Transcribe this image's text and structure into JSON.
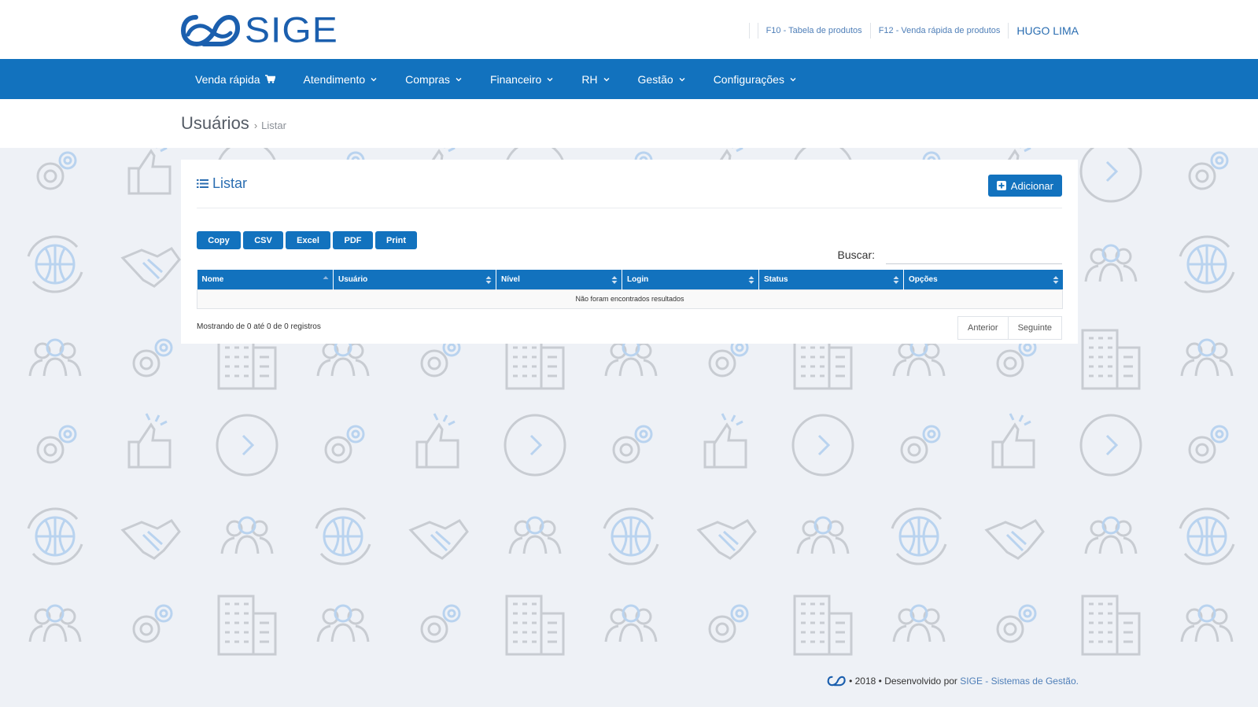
{
  "brand": {
    "name": "SIGE",
    "primary": "#1272be",
    "dark": "#1b5fae"
  },
  "topbar": {
    "links": [
      "F10 - Tabela de produtos",
      "F12 - Venda rápida de produtos"
    ],
    "user": "HUGO LIMA"
  },
  "nav": {
    "items": [
      {
        "label": "Venda rápida",
        "icon": "cart-icon"
      },
      {
        "label": "Atendimento",
        "icon": "chevron-down-icon"
      },
      {
        "label": "Compras",
        "icon": "chevron-down-icon"
      },
      {
        "label": "Financeiro",
        "icon": "chevron-down-icon"
      },
      {
        "label": "RH",
        "icon": "chevron-down-icon"
      },
      {
        "label": "Gestão",
        "icon": "chevron-down-icon"
      },
      {
        "label": "Configurações",
        "icon": "chevron-down-icon"
      }
    ]
  },
  "breadcrumb": {
    "title": "Usuários",
    "separator": "›",
    "current": "Listar"
  },
  "panel": {
    "title": "Listar",
    "add_label": "Adicionar",
    "export_buttons": [
      "Copy",
      "CSV",
      "Excel",
      "PDF",
      "Print"
    ],
    "search": {
      "label": "Buscar:",
      "value": "",
      "placeholder": ""
    },
    "table": {
      "columns": [
        "Nome",
        "Usuário",
        "Nível",
        "Login",
        "Status",
        "Opções"
      ],
      "empty_message": "Não foram encontrados resultados"
    },
    "info": "Mostrando de 0 até 0 de 0 registros",
    "pager": {
      "prev": "Anterior",
      "next": "Seguinte"
    }
  },
  "footer": {
    "text": "• 2018 • Desenvolvido por",
    "link": "SIGE - Sistemas de Gestão."
  }
}
